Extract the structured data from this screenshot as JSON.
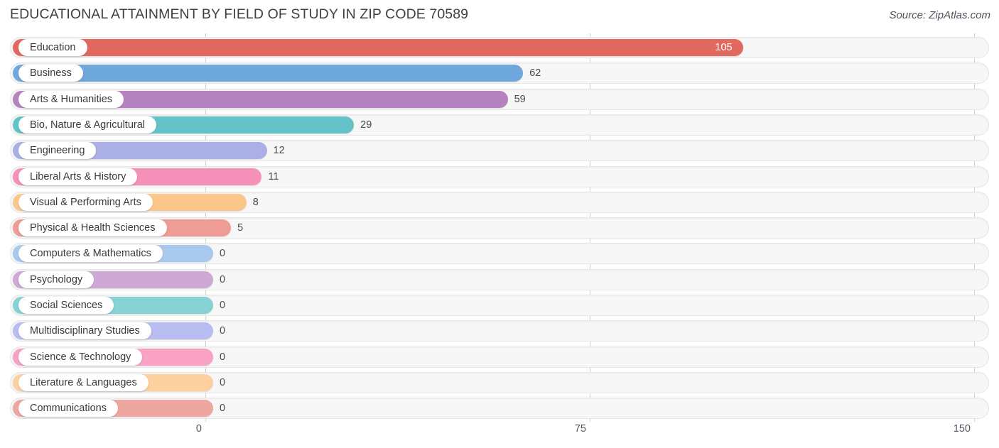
{
  "header": {
    "title": "EDUCATIONAL ATTAINMENT BY FIELD OF STUDY IN ZIP CODE 70589",
    "source": "Source: ZipAtlas.com"
  },
  "chart_data": {
    "type": "bar",
    "orientation": "horizontal",
    "title": "EDUCATIONAL ATTAINMENT BY FIELD OF STUDY IN ZIP CODE 70589",
    "xlabel": "",
    "ylabel": "",
    "xlim": [
      0,
      150
    ],
    "xticks": [
      "0",
      "75",
      "150"
    ],
    "xtick_values": [
      0,
      75,
      150
    ],
    "grid": true,
    "legend": "none",
    "categories": [
      "Education",
      "Business",
      "Arts & Humanities",
      "Bio, Nature & Agricultural",
      "Engineering",
      "Liberal Arts & History",
      "Visual & Performing Arts",
      "Physical & Health Sciences",
      "Computers & Mathematics",
      "Psychology",
      "Social Sciences",
      "Multidisciplinary Studies",
      "Science & Technology",
      "Literature & Languages",
      "Communications"
    ],
    "values": [
      105,
      62,
      59,
      29,
      12,
      11,
      8,
      5,
      0,
      0,
      0,
      0,
      0,
      0,
      0
    ],
    "value_labels": [
      "105",
      "62",
      "59",
      "29",
      "12",
      "11",
      "8",
      "5",
      "0",
      "0",
      "0",
      "0",
      "0",
      "0",
      "0"
    ],
    "colors": [
      "#e2695f",
      "#6fa8dc",
      "#b583c0",
      "#63c3c9",
      "#aab0e6",
      "#f590b8",
      "#fbc68a",
      "#ef9b96",
      "#a9c9ec",
      "#cfa9d6",
      "#86d2d4",
      "#b7bdf0",
      "#f9a2c4",
      "#fdd0a0",
      "#efa5a0"
    ]
  }
}
